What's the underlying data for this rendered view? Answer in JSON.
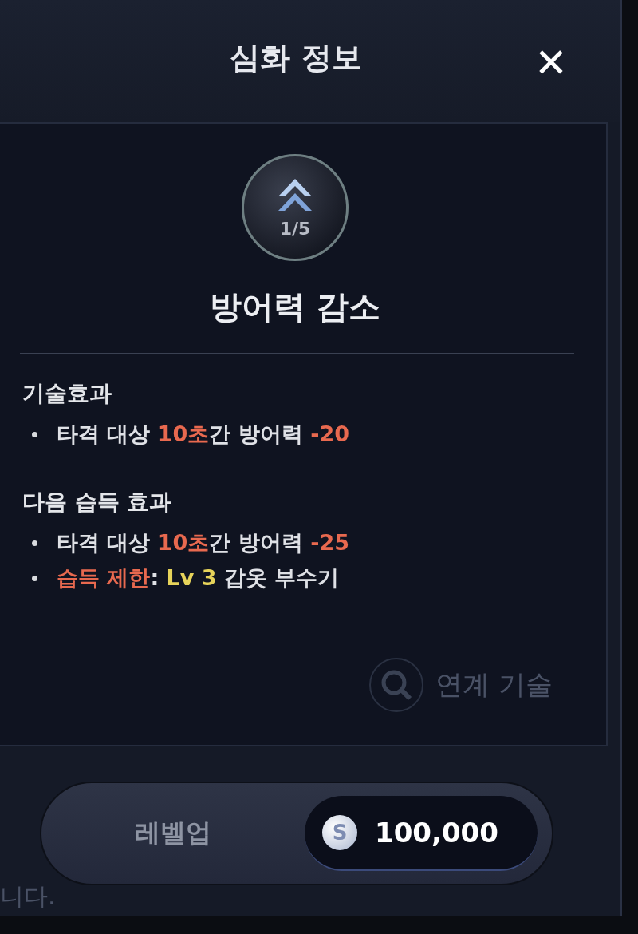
{
  "title": "심화 정보",
  "close_label": "✕",
  "skill": {
    "level_text": "1/5",
    "name": "방어력 감소"
  },
  "sections": [
    {
      "heading": "기술효과",
      "lines": [
        [
          {
            "text": "타격 대상 ",
            "color": "#dfe1e6"
          },
          {
            "text": "10초",
            "color": "#e8694f"
          },
          {
            "text": "간 방어력 ",
            "color": "#dfe1e6"
          },
          {
            "text": "-20",
            "color": "#e8694f"
          }
        ]
      ]
    },
    {
      "heading": "다음 습득 효과",
      "lines": [
        [
          {
            "text": "타격 대상 ",
            "color": "#dfe1e6"
          },
          {
            "text": "10초",
            "color": "#e8694f"
          },
          {
            "text": "간 방어력 ",
            "color": "#dfe1e6"
          },
          {
            "text": "-25",
            "color": "#e8694f"
          }
        ],
        [
          {
            "text": "습득 제한",
            "color": "#e8694f"
          },
          {
            "text": ": ",
            "color": "#dfe1e6"
          },
          {
            "text": "Lv 3",
            "color": "#e6d35a"
          },
          {
            "text": " 갑옷 부수기",
            "color": "#dfe1e6"
          }
        ]
      ]
    }
  ],
  "background_hint": "연계 기술",
  "background_fragment": "니다.",
  "levelup": {
    "label": "레벨업",
    "coin_symbol": "S",
    "cost": "100,000"
  }
}
